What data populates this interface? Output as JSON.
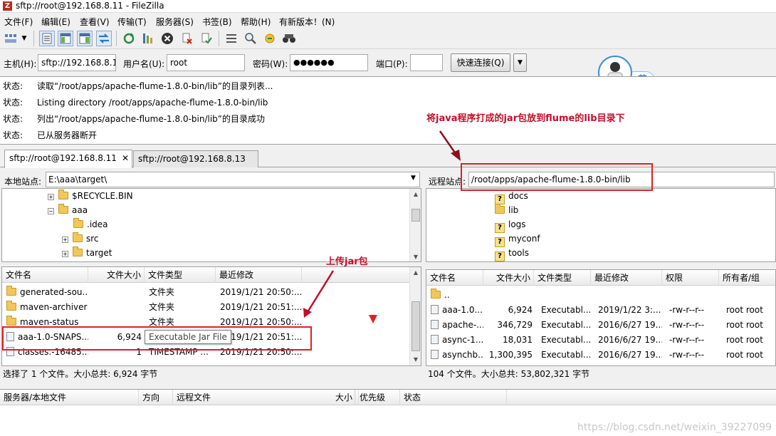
{
  "window": {
    "title": "sftp://root@192.168.8.11 - FileZilla"
  },
  "menu": [
    "文件(F)",
    "编辑(E)",
    "查看(V)",
    "传输(T)",
    "服务器(S)",
    "书签(B)",
    "帮助(H)",
    "有新版本！(N)"
  ],
  "toolbar_icons": [
    "site-manager-icon",
    "dropdown-icon",
    "toggle-log-icon",
    "toggle-local-tree-icon",
    "toggle-remote-tree-icon",
    "toggle-queue-icon",
    "refresh-icon",
    "process-queue-icon",
    "cancel-icon",
    "disconnect-icon",
    "reconnect-icon",
    "directory-filter-icon",
    "search-icon",
    "sync-browse-icon",
    "compare-icon"
  ],
  "quickconnect": {
    "host_label": "主机(H):",
    "host_value": "sftp://192.168.8.11",
    "user_label": "用户名(U):",
    "user_value": "root",
    "pass_label": "密码(W):",
    "pass_value": "●●●●●●",
    "port_label": "端口(P):",
    "port_value": "",
    "connect_label": "快速连接(Q)"
  },
  "avatar_badge": "英",
  "log": [
    {
      "key": "状态:",
      "text": "读取“/root/apps/apache-flume-1.8.0-bin/lib”的目录列表..."
    },
    {
      "key": "状态:",
      "text": "Listing directory /root/apps/apache-flume-1.8.0-bin/lib"
    },
    {
      "key": "状态:",
      "text": "列出“/root/apps/apache-flume-1.8.0-bin/lib”的目录成功"
    },
    {
      "key": "状态:",
      "text": "已从服务器断开"
    }
  ],
  "annotations": {
    "remote_note": "将java程序打成的jar包放到flume的lib目录下",
    "upload_note": "上传jar包"
  },
  "tabs": [
    "sftp://root@192.168.8.11",
    "sftp://root@192.168.8.13"
  ],
  "local": {
    "site_label": "本地站点:",
    "site_path": "E:\\aaa\\target\\",
    "tree": [
      {
        "name": "$RECYCLE.BIN",
        "exp": "+"
      },
      {
        "name": "aaa",
        "exp": "−"
      },
      {
        "name": ".idea",
        "exp": ""
      },
      {
        "name": "src",
        "exp": "+"
      },
      {
        "name": "target",
        "exp": "+"
      }
    ],
    "columns": [
      "文件名",
      "文件大小",
      "文件类型",
      "最近修改"
    ],
    "files": [
      {
        "name": "generated-sou...",
        "size": "",
        "type": "文件夹",
        "modified": "2019/1/21 20:50:..."
      },
      {
        "name": "maven-archiver",
        "size": "",
        "type": "文件夹",
        "modified": "2019/1/21 20:51:..."
      },
      {
        "name": "maven-status",
        "size": "",
        "type": "文件夹",
        "modified": "2019/1/21 20:50:..."
      },
      {
        "name": "aaa-1.0-SNAPS...",
        "size": "6,924",
        "type": "",
        "modified": "2019/1/21 20:51:..."
      },
      {
        "name": "classes.-16485...",
        "size": "1",
        "type": "TIMESTAMP ...",
        "modified": "2019/1/21 20:50:..."
      }
    ],
    "tooltip": "Executable Jar File",
    "status": "选择了 1 个文件。大小总共: 6,924 字节"
  },
  "remote": {
    "site_label": "远程站点:",
    "site_path": "/root/apps/apache-flume-1.8.0-bin/lib",
    "tree": [
      {
        "name": "docs"
      },
      {
        "name": "lib"
      },
      {
        "name": "logs"
      },
      {
        "name": "myconf"
      },
      {
        "name": "tools"
      }
    ],
    "columns": [
      "文件名",
      "文件大小",
      "文件类型",
      "最近修改",
      "权限",
      "所有者/组"
    ],
    "files": [
      {
        "name": "..",
        "size": "",
        "type": "",
        "modified": "",
        "perm": "",
        "owner": ""
      },
      {
        "name": "aaa-1.0...",
        "size": "6,924",
        "type": "Executabl...",
        "modified": "2019/1/22 3:...",
        "perm": "-rw-r--r--",
        "owner": "root root"
      },
      {
        "name": "apache-...",
        "size": "346,729",
        "type": "Executabl...",
        "modified": "2016/6/27 19...",
        "perm": "-rw-r--r--",
        "owner": "root root"
      },
      {
        "name": "async-1....",
        "size": "18,031",
        "type": "Executabl...",
        "modified": "2016/6/27 19...",
        "perm": "-rw-r--r--",
        "owner": "root root"
      },
      {
        "name": "asynchb...",
        "size": "1,300,395",
        "type": "Executabl...",
        "modified": "2016/6/27 19...",
        "perm": "-rw-r--r--",
        "owner": "root root"
      }
    ],
    "status": "104 个文件。大小总共: 53,802,321 字节"
  },
  "queue": {
    "columns": [
      "服务器/本地文件",
      "方向",
      "远程文件",
      "大小",
      "优先级",
      "状态"
    ]
  },
  "watermark": "https://blog.csdn.net/weixin_39227099",
  "colors": {
    "annotation": "#c0102a",
    "highlight_box": "#e02020",
    "folder": "#f1c75a"
  }
}
